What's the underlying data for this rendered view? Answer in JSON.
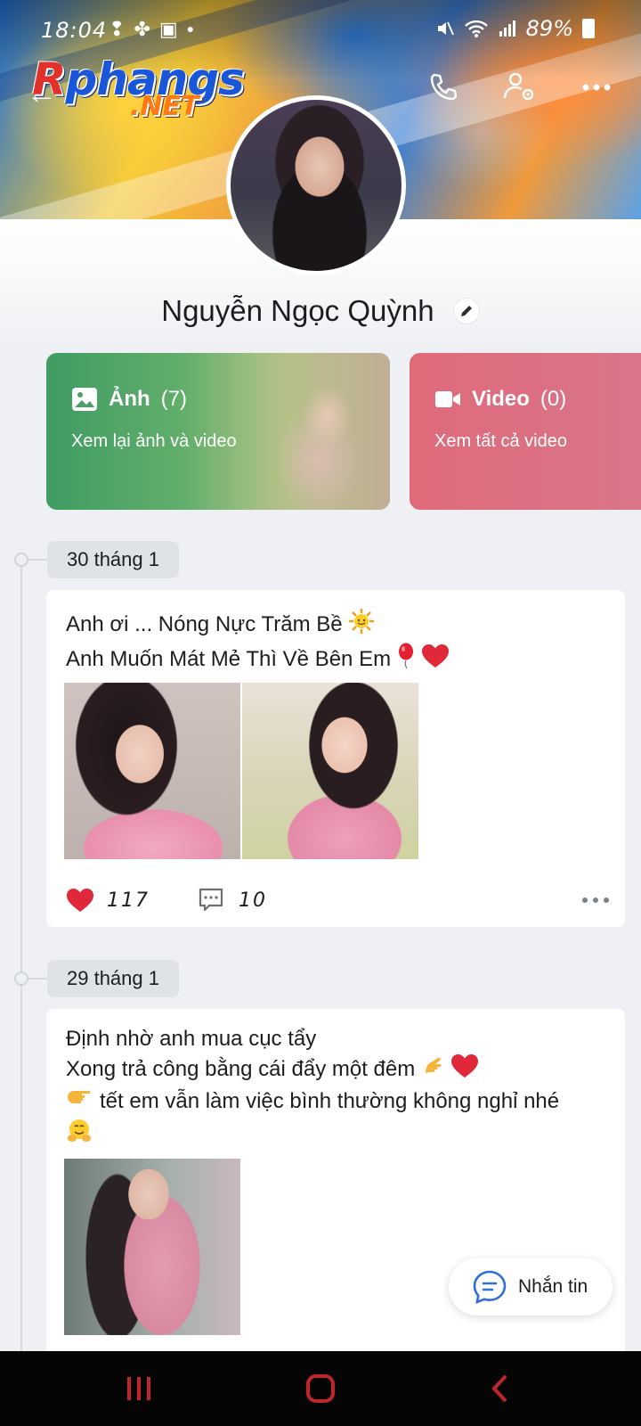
{
  "status_bar": {
    "time": "18:04",
    "battery": "89%"
  },
  "watermark": {
    "logo_main": "Rphangs",
    "logo_sub": ".NET"
  },
  "profile": {
    "name": "Nguyễn Ngọc Quỳnh"
  },
  "albums": {
    "photos": {
      "label": "Ảnh",
      "count": "(7)",
      "subtitle": "Xem lại ảnh và video"
    },
    "videos": {
      "label": "Video",
      "count": "(0)",
      "subtitle": "Xem tất cả video"
    }
  },
  "posts": [
    {
      "date": "30 tháng 1",
      "lines": [
        "Anh ơi ... Nóng Nực Trăm Bề",
        "Anh Muốn Mát Mẻ Thì Về Bên Em"
      ],
      "likes": "117",
      "comments": "10"
    },
    {
      "date": "29 tháng 1",
      "lines": [
        "Định nhờ anh mua cục tẩy",
        "Xong trả công bằng cái đẩy một đêm",
        "tết em vẫn làm việc bình thường không nghỉ nhé"
      ]
    }
  ],
  "message_button": {
    "label": "Nhắn tin"
  },
  "colors": {
    "photos_card": "#4c9f67",
    "videos_card": "#de6b7c",
    "like_heart": "#e0283a",
    "accent_blue": "#2f6fd8"
  }
}
